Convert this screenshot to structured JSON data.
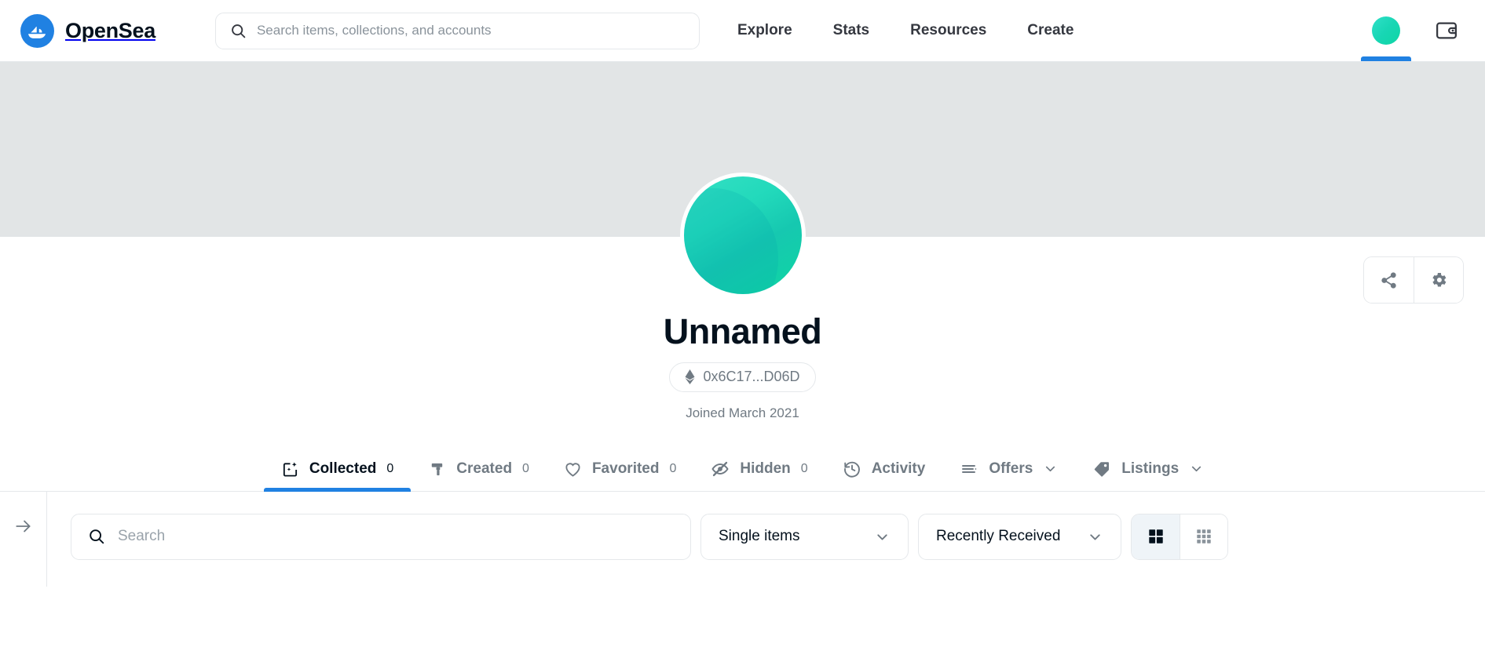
{
  "header": {
    "brand_name": "OpenSea",
    "brand_logo_icon": "opensea-sail-logo",
    "search": {
      "placeholder": "Search items, collections, and accounts",
      "value": "",
      "icon": "search-icon"
    },
    "nav": [
      {
        "label": "Explore"
      },
      {
        "label": "Stats"
      },
      {
        "label": "Resources"
      },
      {
        "label": "Create"
      }
    ],
    "account_avatar_icon": "account-avatar",
    "wallet_icon": "wallet-icon",
    "active_accent_color": "#2081e2"
  },
  "banner": {
    "color": "#e2e5e6"
  },
  "profile": {
    "avatar_icon": "profile-avatar",
    "name": "Unnamed",
    "address": "0x6C17...D06D",
    "address_chain_icon": "ethereum-icon",
    "joined": "Joined March 2021",
    "actions": [
      {
        "name": "share-button",
        "icon": "share-icon"
      },
      {
        "name": "settings-button",
        "icon": "gear-icon"
      }
    ]
  },
  "tabs": [
    {
      "label": "Collected",
      "count": "0",
      "icon": "collected-icon",
      "active": true
    },
    {
      "label": "Created",
      "count": "0",
      "icon": "created-icon",
      "active": false
    },
    {
      "label": "Favorited",
      "count": "0",
      "icon": "heart-icon",
      "active": false
    },
    {
      "label": "Hidden",
      "count": "0",
      "icon": "eye-off-icon",
      "active": false
    },
    {
      "label": "Activity",
      "count": "",
      "icon": "history-icon",
      "active": false
    },
    {
      "label": "Offers",
      "count": "",
      "icon": "list-icon",
      "active": false,
      "chevron": true
    },
    {
      "label": "Listings",
      "count": "",
      "icon": "tag-icon",
      "active": false,
      "chevron": true
    }
  ],
  "filter_bar": {
    "expand_sidebar_icon": "arrow-right-icon",
    "search": {
      "placeholder": "Search",
      "value": "",
      "icon": "search-icon"
    },
    "items_select": {
      "value": "Single items",
      "chevron_icon": "chevron-down-icon"
    },
    "sort_select": {
      "value": "Recently Received",
      "chevron_icon": "chevron-down-icon"
    },
    "view_modes": [
      {
        "name": "grid-large-view",
        "icon": "grid-2x2-icon",
        "active": true
      },
      {
        "name": "grid-small-view",
        "icon": "grid-3x3-icon",
        "active": false
      }
    ]
  }
}
